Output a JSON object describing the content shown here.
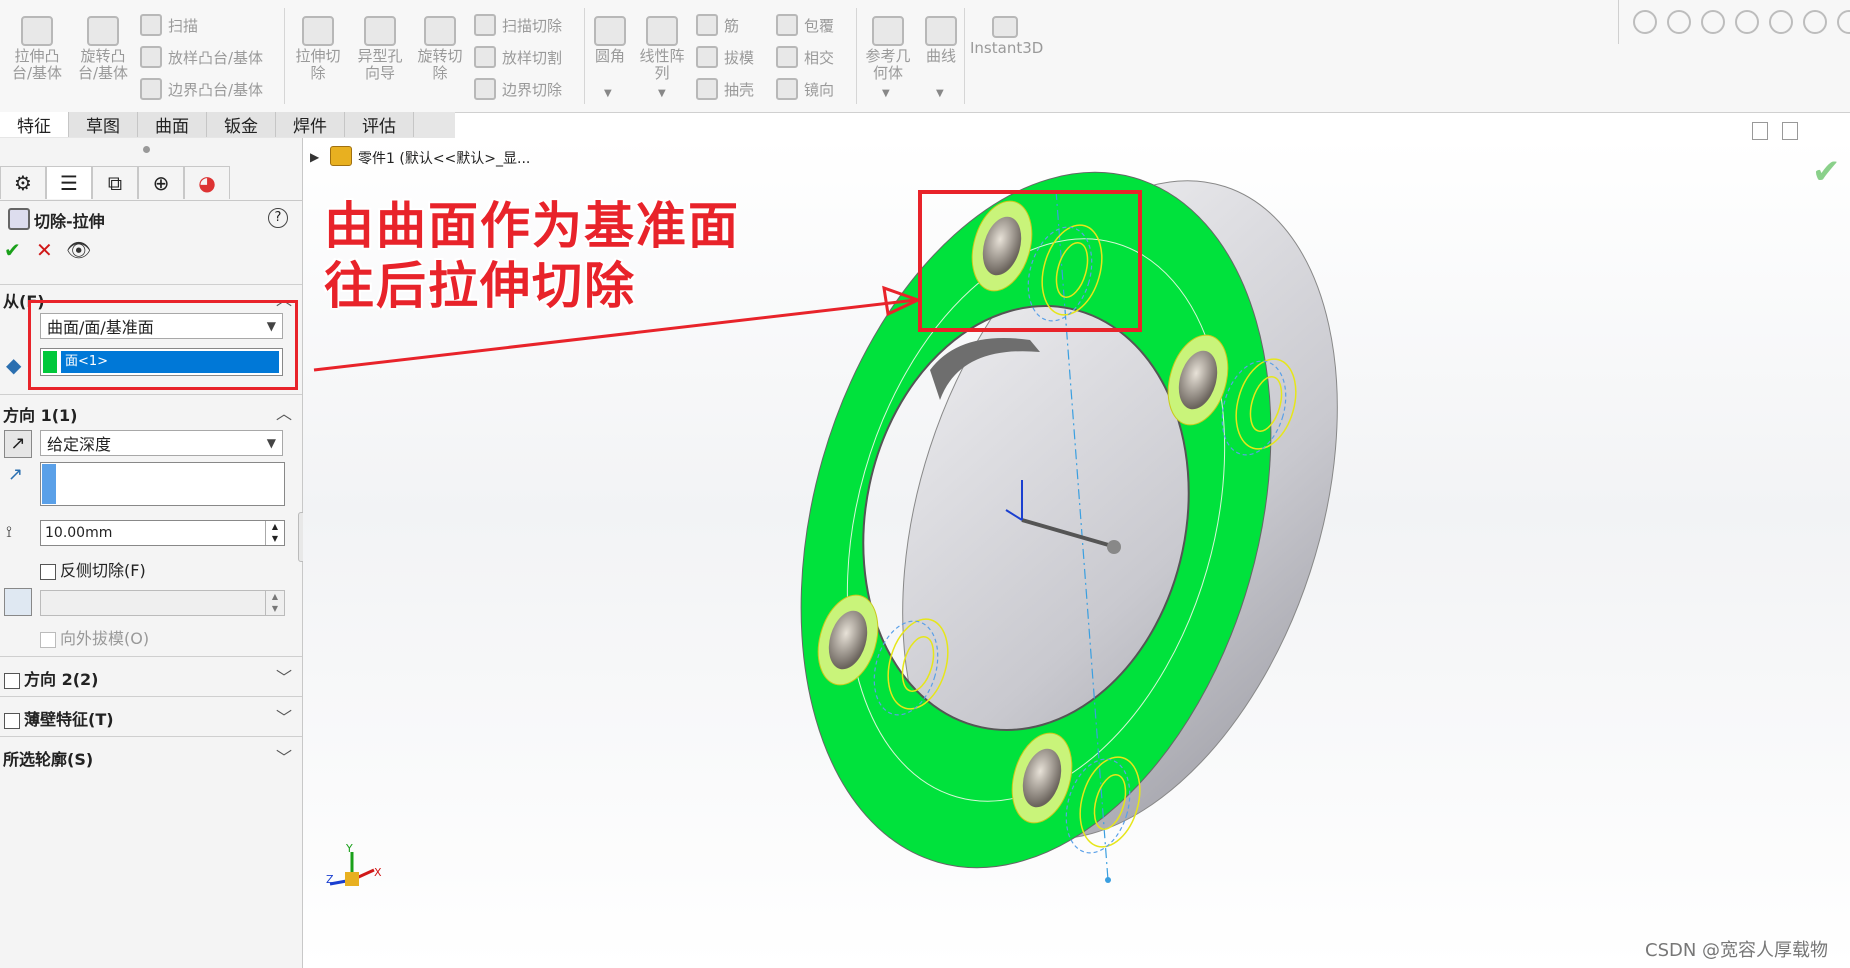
{
  "ribbon": {
    "big_buttons": [
      {
        "label": "拉伸凸\n台/基体",
        "icon": "extruded-boss-icon"
      },
      {
        "label": "旋转凸\n台/基体",
        "icon": "revolved-boss-icon"
      },
      {
        "label": "拉伸切\n除",
        "icon": "extruded-cut-icon"
      },
      {
        "label": "异型孔\n向导",
        "icon": "hole-wizard-icon"
      },
      {
        "label": "旋转切\n除",
        "icon": "revolved-cut-icon"
      },
      {
        "label": "圆角",
        "icon": "fillet-icon"
      },
      {
        "label": "线性阵\n列",
        "icon": "linear-pattern-icon"
      },
      {
        "label": "参考几\n何体",
        "icon": "reference-geometry-icon"
      },
      {
        "label": "曲线",
        "icon": "curves-icon"
      },
      {
        "label": "Instant3D",
        "icon": "instant3d-icon"
      }
    ],
    "small_buttons": [
      {
        "label": "扫描",
        "icon": "sweep-icon"
      },
      {
        "label": "放样凸台/基体",
        "icon": "loft-icon"
      },
      {
        "label": "边界凸台/基体",
        "icon": "boundary-boss-icon"
      },
      {
        "label": "扫描切除",
        "icon": "swept-cut-icon"
      },
      {
        "label": "放样切割",
        "icon": "lofted-cut-icon"
      },
      {
        "label": "边界切除",
        "icon": "boundary-cut-icon"
      },
      {
        "label": "筋",
        "icon": "rib-icon"
      },
      {
        "label": "拔模",
        "icon": "draft-icon"
      },
      {
        "label": "抽壳",
        "icon": "shell-icon"
      },
      {
        "label": "包覆",
        "icon": "wrap-icon"
      },
      {
        "label": "相交",
        "icon": "intersect-icon"
      },
      {
        "label": "镜向",
        "icon": "mirror-icon"
      }
    ]
  },
  "tabs": [
    "特征",
    "草图",
    "曲面",
    "钣金",
    "焊件",
    "评估"
  ],
  "tree": {
    "item": "零件1 (默认<<默认>_显..."
  },
  "panel": {
    "title": "切除-拉伸",
    "from": {
      "header": "从(F)",
      "start_condition": "曲面/面/基准面",
      "selection": "面<1>"
    },
    "direction1": {
      "header": "方向 1(1)",
      "end_condition": "给定深度",
      "depth": "10.00mm",
      "flip_side_label": "反侧切除(F)",
      "draft_outward_label": "向外拔模(O)"
    },
    "direction2_label": "方向 2(2)",
    "thin_feature_label": "薄壁特征(T)",
    "selected_contours_label": "所选轮廓(S)"
  },
  "annotation": {
    "line1": "由曲面作为基准面",
    "line2": "往后拉伸切除",
    "color": "#e8232a"
  },
  "watermark": "CSDN @宽容人厚载物",
  "colors": {
    "face_green": "#00e23c",
    "selection_blue": "#0078d7",
    "accent_red": "#e8232a"
  }
}
